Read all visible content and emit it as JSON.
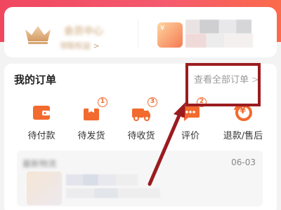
{
  "membership": {
    "title": "会员中心",
    "subtitle": "领取权益",
    "subtitle_arrow": ">"
  },
  "coupon": {
    "label": "¥"
  },
  "orders": {
    "title": "我的订单",
    "view_all": "查看全部订单",
    "view_all_chevron": ">",
    "statuses": [
      {
        "label": "待付款",
        "icon": "wallet-icon",
        "badge": ""
      },
      {
        "label": "待发货",
        "icon": "package-icon",
        "badge": "1"
      },
      {
        "label": "待收货",
        "icon": "truck-icon",
        "badge": "3"
      },
      {
        "label": "评价",
        "icon": "comment-icon",
        "badge": "2"
      },
      {
        "label": "退款/售后",
        "icon": "refund-icon",
        "badge": "¥"
      }
    ]
  },
  "logistics": {
    "label": "最新物流",
    "date": "06-03"
  },
  "colors": {
    "brand_red": "#f0475f",
    "icon_orange": "#f26a2e",
    "highlight_box": "#9b1c1f"
  }
}
